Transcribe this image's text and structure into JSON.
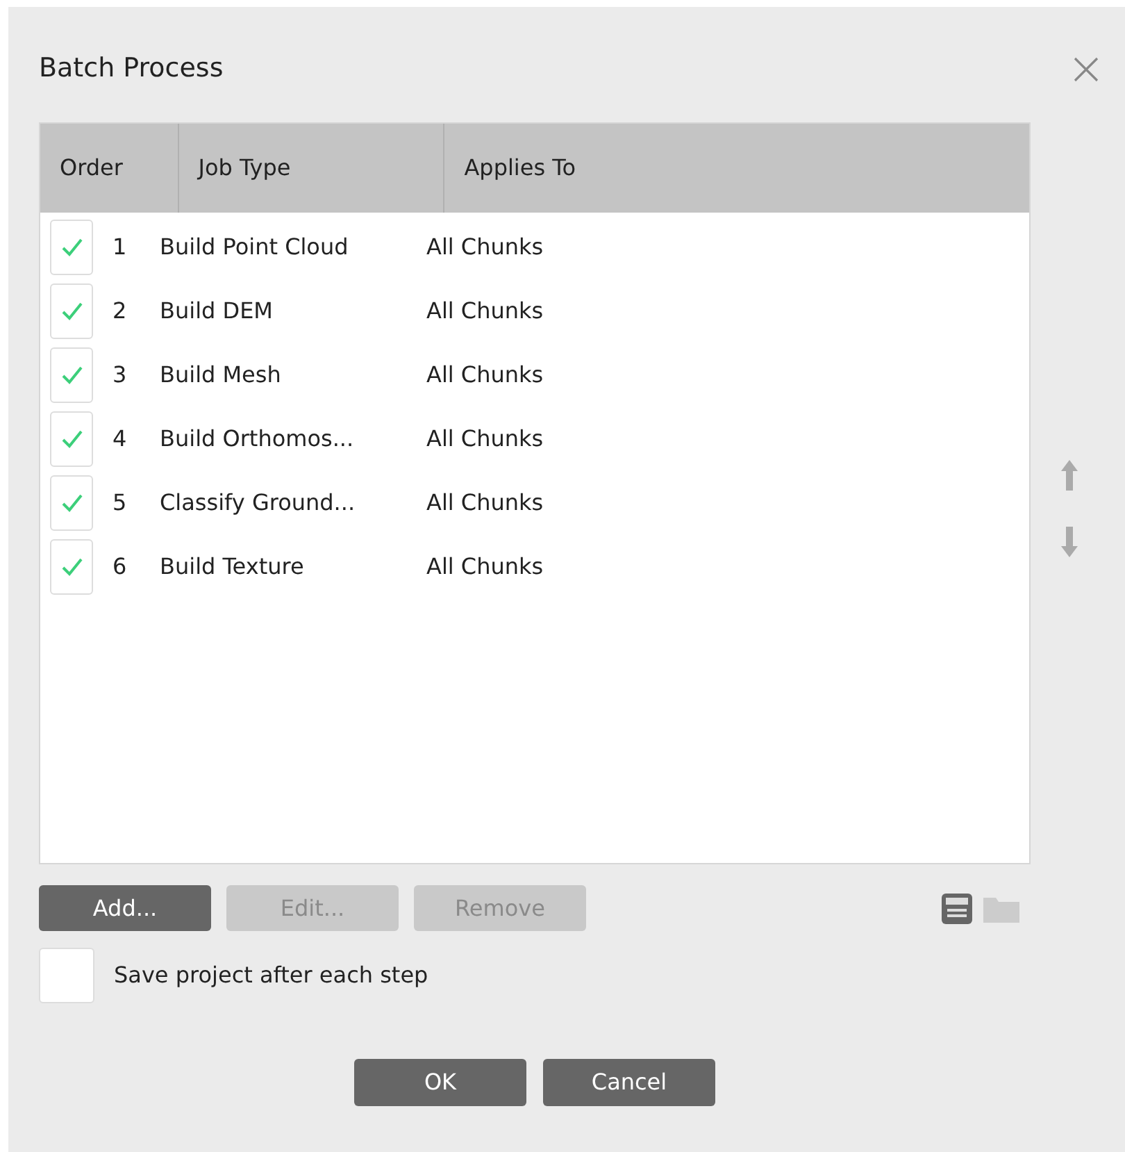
{
  "window": {
    "title": "Batch Process"
  },
  "table": {
    "columns": [
      "Order",
      "Job Type",
      "Applies To"
    ],
    "rows": [
      {
        "checked": true,
        "order": "1",
        "job_type": "Build Point Cloud",
        "applies_to": "All Chunks"
      },
      {
        "checked": true,
        "order": "2",
        "job_type": "Build DEM",
        "applies_to": "All Chunks"
      },
      {
        "checked": true,
        "order": "3",
        "job_type": "Build Mesh",
        "applies_to": "All Chunks"
      },
      {
        "checked": true,
        "order": "4",
        "job_type": "Build Orthomos...",
        "applies_to": "All Chunks"
      },
      {
        "checked": true,
        "order": "5",
        "job_type": "Classify Ground...",
        "applies_to": "All Chunks"
      },
      {
        "checked": true,
        "order": "6",
        "job_type": "Build Texture",
        "applies_to": "All Chunks"
      }
    ]
  },
  "list_buttons": [
    {
      "label": "Add...",
      "disabled": false
    },
    {
      "label": "Edit...",
      "disabled": true
    },
    {
      "label": "Remove",
      "disabled": true
    }
  ],
  "save_after_each_step": {
    "label": "Save project after each step",
    "checked": false
  },
  "dialog_buttons": [
    "OK",
    "Cancel"
  ]
}
